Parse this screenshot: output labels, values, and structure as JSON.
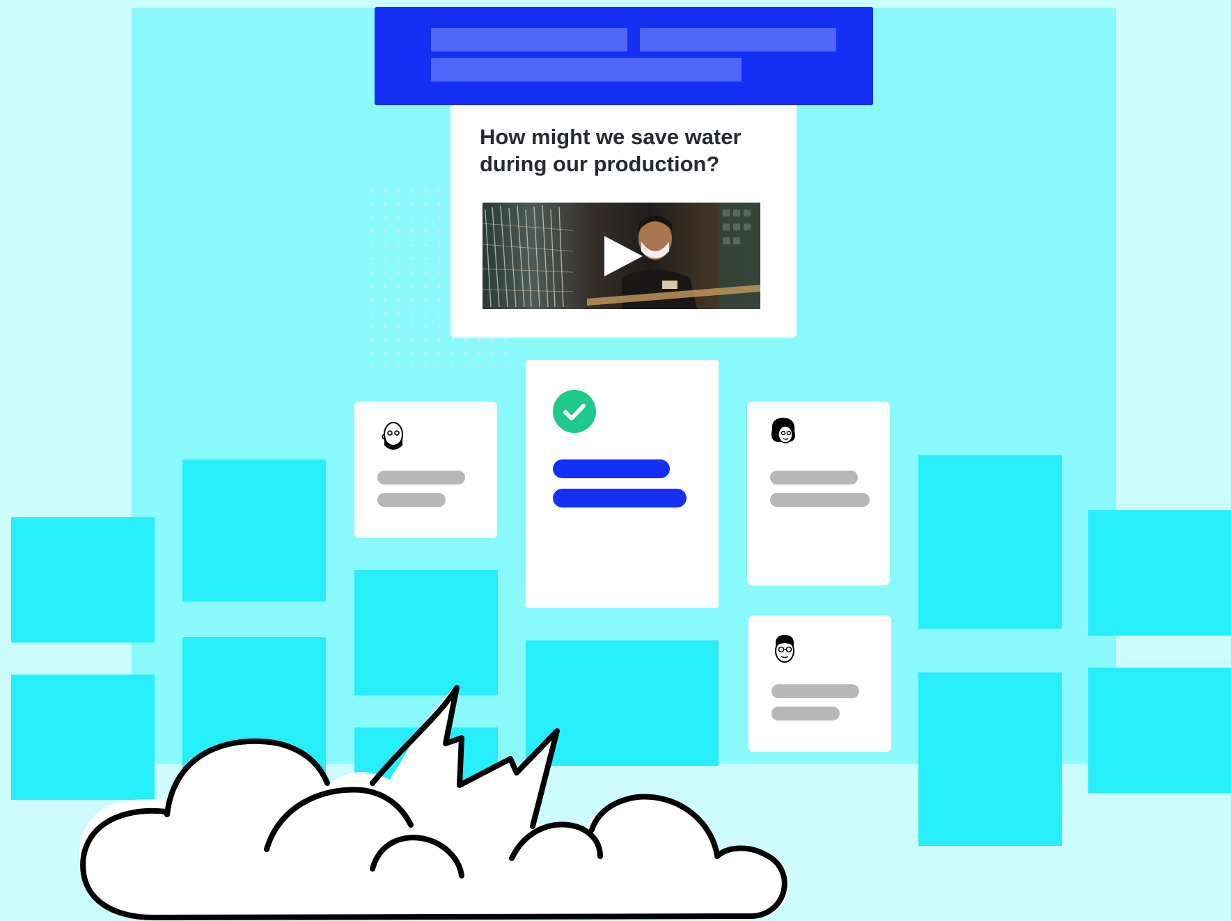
{
  "prompt": {
    "title": "How might we save water during our production?",
    "video": {
      "play_icon": "play-icon",
      "thumbnail": "factory-worker-with-face-mask"
    }
  },
  "cards": {
    "approved": {
      "status_icon": "check-circle-icon",
      "status_color": "#1ec98a"
    },
    "contributors": [
      {
        "avatar": "bald-man-with-mask-avatar"
      },
      {
        "avatar": "curly-hair-woman-avatar"
      },
      {
        "avatar": "man-with-glasses-avatar"
      }
    ]
  },
  "decoration": {
    "cloud": "cartoon-cloud-burst"
  },
  "colors": {
    "brand_blue": "#1530f5",
    "board": "#8af9fc",
    "sticky": "#27eefb",
    "background": "#ccfcfd",
    "placeholder_gray": "#b7b7b7"
  }
}
